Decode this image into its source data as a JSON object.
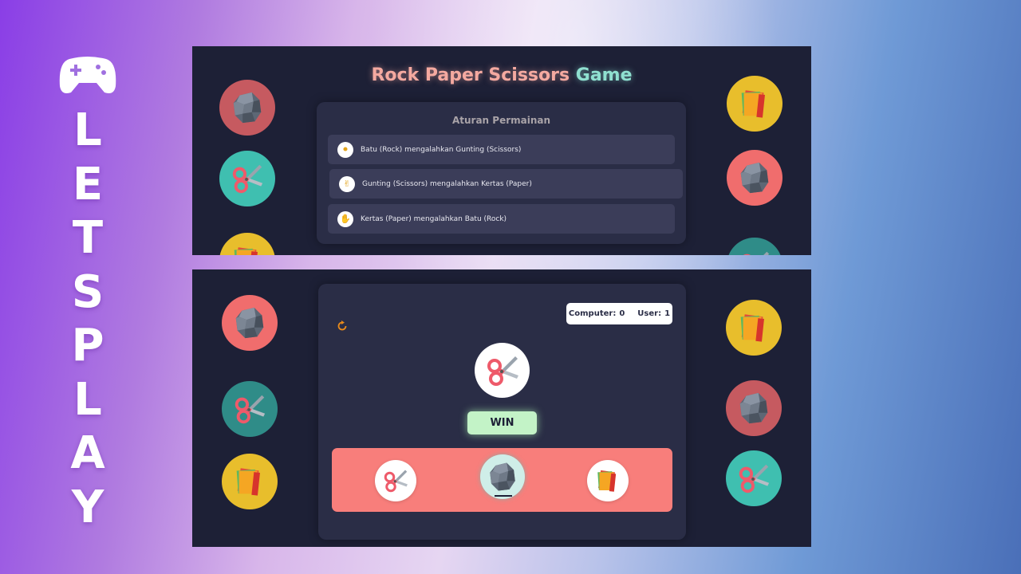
{
  "side_title": {
    "icon": "gamepad-icon",
    "letters": [
      "L",
      "E",
      "T",
      "S",
      "P",
      "L",
      "A",
      "Y"
    ]
  },
  "game": {
    "title_part1": "Rock Paper Scissors",
    "title_part2": "Game"
  },
  "rules": {
    "heading": "Aturan Permainan",
    "items": [
      {
        "icon": "fist-icon",
        "text": "Batu (Rock) mengalahkan Gunting (Scissors)"
      },
      {
        "icon": "victory-hand-icon",
        "text": "Gunting (Scissors) mengalahkan Kertas (Paper)"
      },
      {
        "icon": "open-hand-icon",
        "text": "Kertas (Paper) mengalahkan Batu (Rock)"
      }
    ]
  },
  "score": {
    "computer_label": "Computer:",
    "computer_value": "0",
    "user_label": "User:",
    "user_value": "1"
  },
  "result": {
    "choice_icon": "scissors-icon",
    "label": "WIN"
  },
  "choices": [
    {
      "name": "scissors",
      "icon": "scissors-icon"
    },
    {
      "name": "rock",
      "icon": "rock-icon",
      "selected": true
    },
    {
      "name": "paper",
      "icon": "paper-icon"
    }
  ],
  "colors": {
    "panel_bg": "#1d2036",
    "card_bg": "#2a2d46",
    "choice_bar": "#f87e7b",
    "win_badge": "#c3f3c7",
    "title_pink": "#f4a9a0",
    "title_teal": "#8fe0d0"
  }
}
